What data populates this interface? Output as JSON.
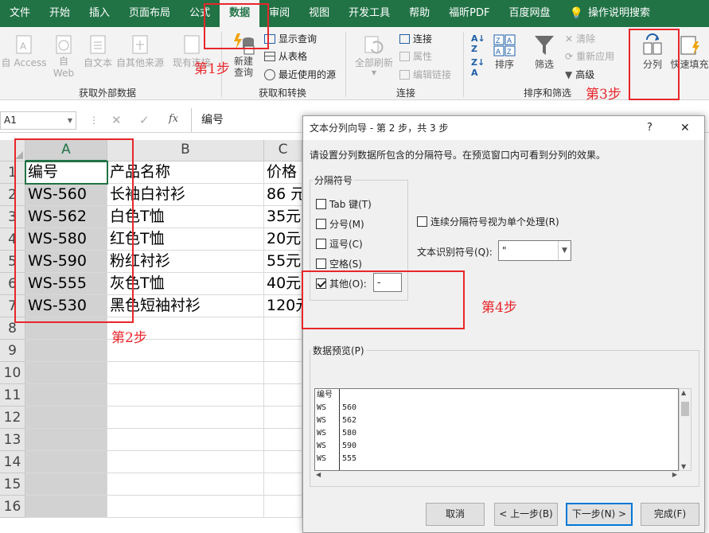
{
  "tabs": [
    "文件",
    "开始",
    "插入",
    "页面布局",
    "公式",
    "数据",
    "审阅",
    "视图",
    "开发工具",
    "帮助",
    "福昕PDF",
    "百度网盘"
  ],
  "tab_active_index": 5,
  "tell_me": "操作说明搜索",
  "ribbon": {
    "get_external": {
      "label": "获取外部数据",
      "buttons": [
        "自 Access",
        "自\nWeb",
        "自文本",
        "自其他来源",
        "现有连接"
      ]
    },
    "get_transform": {
      "label": "获取和转换",
      "new_query": "新建\n查询",
      "show_query": "显示查询",
      "from_table": "从表格",
      "recent_sources": "最近使用的源"
    },
    "connections": {
      "label": "连接",
      "refresh_all": "全部刷新",
      "connections": "连接",
      "properties": "属性",
      "edit_links": "编辑链接"
    },
    "sort_filter": {
      "label": "排序和筛选",
      "sort": "排序",
      "filter": "筛选",
      "clear": "清除",
      "reapply": "重新应用",
      "advanced": "高级"
    },
    "data_tools": {
      "split": "分列",
      "flash_fill": "快速填充"
    }
  },
  "name_box": "A1",
  "formula": "编号",
  "columns": [
    "A",
    "B"
  ],
  "column_c_partial": "C",
  "rows": [
    [
      "编号",
      "产品名称",
      "价格"
    ],
    [
      "WS-560",
      "长袖白衬衫",
      "86 元"
    ],
    [
      "WS-562",
      "白色T恤",
      "35元"
    ],
    [
      "WS-580",
      "红色T恤",
      "20元"
    ],
    [
      "WS-590",
      "粉红衬衫",
      "55元"
    ],
    [
      "WS-555",
      "灰色T恤",
      "40元"
    ],
    [
      "WS-530",
      "黑色短袖衬衫",
      "120元"
    ]
  ],
  "row_numbers": [
    "1",
    "2",
    "3",
    "4",
    "5",
    "6",
    "7",
    "8",
    "9",
    "10",
    "11",
    "12",
    "13",
    "14",
    "15",
    "16"
  ],
  "annotations": {
    "step1": "第1步",
    "step2": "第2步",
    "step3": "第3步",
    "step4": "第4步"
  },
  "dialog": {
    "title": "文本分列向导 - 第 2 步，共 3 步",
    "help": "?",
    "close": "✕",
    "instruction": "请设置分列数据所包含的分隔符号。在预览窗口内可看到分列的效果。",
    "delimiters_label": "分隔符号",
    "options": [
      {
        "label": "Tab 键(T)",
        "checked": false
      },
      {
        "label": "分号(M)",
        "checked": false
      },
      {
        "label": "逗号(C)",
        "checked": false
      },
      {
        "label": "空格(S)",
        "checked": false
      },
      {
        "label": "其他(O):",
        "checked": true
      }
    ],
    "other_value": "-",
    "consecutive": {
      "label": "连续分隔符号视为单个处理(R)",
      "checked": false
    },
    "qualifier_label": "文本识别符号(Q):",
    "qualifier_value": "\"",
    "preview_label": "数据预览(P)",
    "preview": [
      [
        "编号",
        ""
      ],
      [
        "WS",
        "560"
      ],
      [
        "WS",
        "562"
      ],
      [
        "WS",
        "580"
      ],
      [
        "WS",
        "590"
      ],
      [
        "WS",
        "555"
      ]
    ],
    "buttons": {
      "cancel": "取消",
      "back": "< 上一步(B)",
      "next": "下一步(N) >",
      "finish": "完成(F)"
    }
  }
}
